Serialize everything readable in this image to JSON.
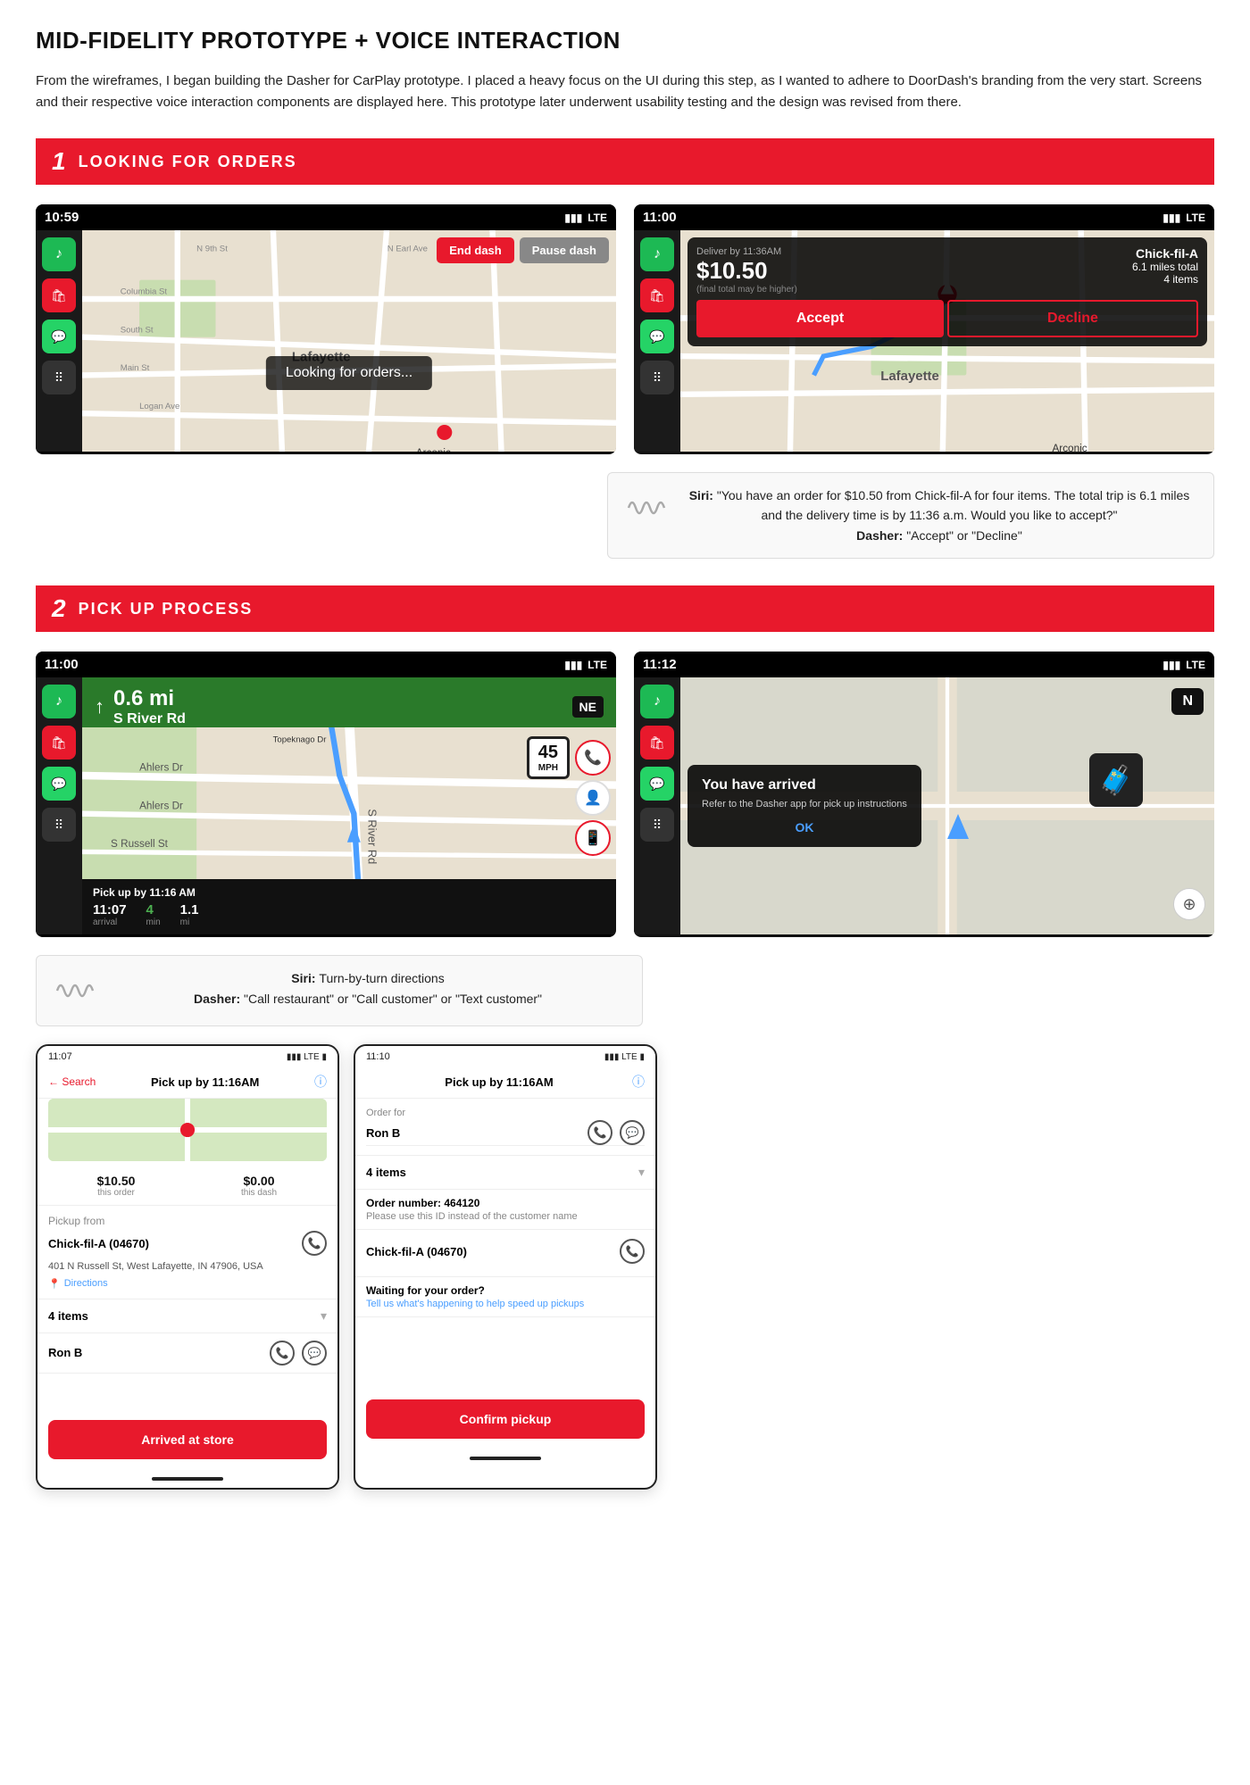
{
  "page": {
    "main_title": "MID-FIDELITY PROTOTYPE + VOICE INTERACTION",
    "intro_text": "From the wireframes, I began building the Dasher for CarPlay prototype. I placed a heavy focus on the UI during this step, as I wanted to adhere to DoorDash's branding from the very start. Screens and their respective voice interaction components are displayed here. This prototype later underwent usability testing and the design was revised from there."
  },
  "section1": {
    "num": "1",
    "title": "LOOKING FOR ORDERS",
    "screen1": {
      "time": "10:59",
      "signal": "▮▮▮",
      "network": "LTE",
      "buttons": {
        "end_dash": "End dash",
        "pause_dash": "Pause dash"
      },
      "overlay_text": "Looking for orders..."
    },
    "screen2": {
      "time": "11:00",
      "signal": "▮▮▮",
      "network": "LTE",
      "order": {
        "deliver_by": "Deliver by 11:36AM",
        "restaurant": "Chick-fil-A",
        "price": "$10.50",
        "price_note": "(final total may be higher)",
        "miles": "6.1 miles total",
        "items": "4 items",
        "accept": "Accept",
        "decline": "Decline"
      }
    },
    "voice1": {
      "siri_text": "Siri: \"You have an order for $10.50 from Chick-fil-A for four items. The total trip is 6.1 miles and the delivery time is by 11:36 a.m. Would you like to accept?\"",
      "dasher_text": "Dasher: \"Accept\" or \"Decline\""
    }
  },
  "section2": {
    "num": "2",
    "title": "PICK UP PROCESS",
    "nav_screen": {
      "time": "11:00",
      "signal": "▮▮▮",
      "network": "LTE",
      "direction": {
        "arrow": "↑",
        "distance": "0.6 mi",
        "street": "S River Rd",
        "compass": "NE"
      },
      "speed": {
        "num": "45",
        "unit": "MPH"
      },
      "pickup": {
        "label": "Pick up by 11:16 AM",
        "time": "11:07",
        "mins": "4",
        "miles": "1.1",
        "time_label": "arrival",
        "mins_label": "min",
        "miles_label": "mi"
      },
      "action_btns": [
        "📞",
        "👤",
        "📱"
      ]
    },
    "arrived_screen": {
      "time": "11:12",
      "signal": "▮▮▮",
      "network": "LTE",
      "compass": "N",
      "card": {
        "title": "You have arrived",
        "subtitle": "Refer to the Dasher app for pick up instructions",
        "ok": "OK"
      }
    },
    "voice2": {
      "siri_text": "Siri: Turn-by-turn directions",
      "dasher_text": "Dasher: \"Call restaurant\" or \"Call customer\" or \"Text customer\""
    },
    "phone1": {
      "time": "11:07",
      "network": "LTE",
      "pickup_time": "Pick up by 11:16AM",
      "earnings": {
        "this_order": "$10.50",
        "this_dash": "$0.00",
        "order_label": "this order",
        "dash_label": "this dash"
      },
      "pickup_from": "Pickup from",
      "restaurant": "Chick-fil-A (04670)",
      "restaurant_address": "401 N Russell St, West Lafayette, IN 47906, USA",
      "directions": "Directions",
      "items": "4 items",
      "customer_name": "Ron B",
      "bottom_btn": "Arrived at store"
    },
    "phone2": {
      "time": "11:10",
      "network": "LTE",
      "pickup_time": "Pick up by 11:16AM",
      "order_for_label": "Order for",
      "customer_name": "Ron B",
      "items": "4 items",
      "order_num_label": "Order number: 464120",
      "order_num_note": "Please use this ID instead of the customer name",
      "restaurant": "Chick-fil-A (04670)",
      "waiting_label": "Waiting for your order?",
      "waiting_link": "Tell us what's happening to help speed up pickups",
      "bottom_btn": "Confirm pickup"
    }
  },
  "colors": {
    "brand_red": "#e8192c",
    "carplay_bg": "#000000",
    "map_bg": "#e8e0d0",
    "nav_green": "#2a7a2a",
    "blue_route": "#4a9eff"
  }
}
